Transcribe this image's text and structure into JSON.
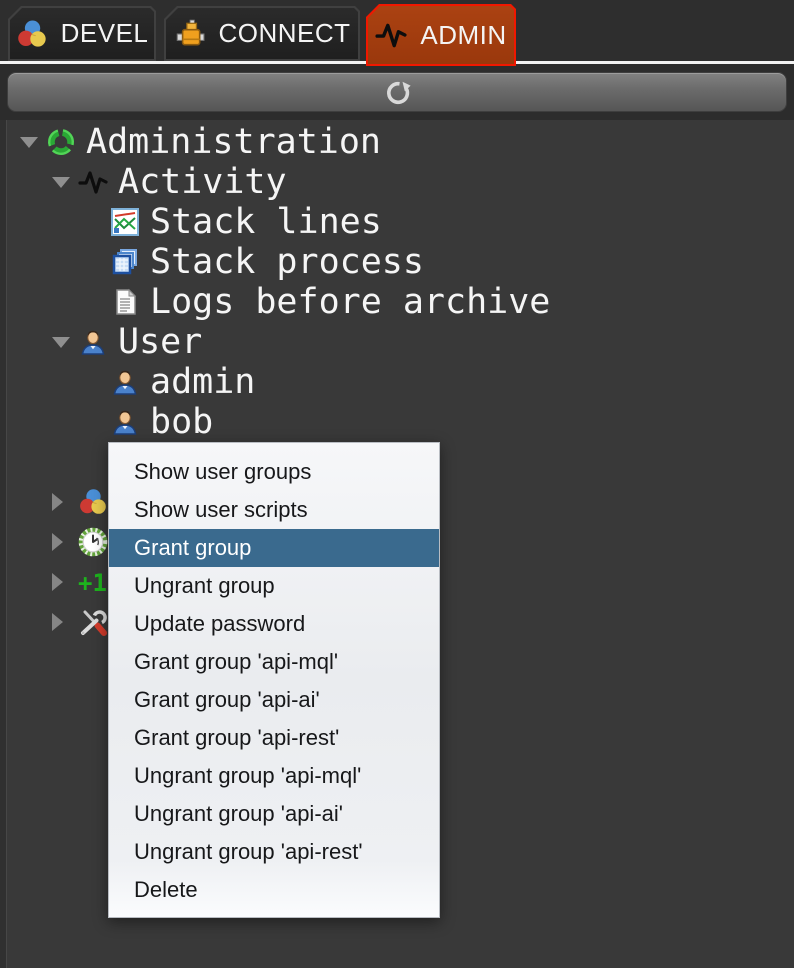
{
  "tabs": [
    {
      "label": "DEVEL",
      "icon": "color-circles-icon",
      "active": false
    },
    {
      "label": "CONNECT",
      "icon": "connector-icon",
      "active": false
    },
    {
      "label": "ADMIN",
      "icon": "pulse-icon",
      "active": true
    }
  ],
  "toolbar": {
    "refresh_icon": "refresh-icon"
  },
  "tree": {
    "items": [
      {
        "row": 0,
        "level": 0,
        "state": "expanded",
        "icon": "ring-icon",
        "label": "Administration"
      },
      {
        "row": 1,
        "level": 1,
        "state": "expanded",
        "icon": "pulse-icon",
        "label": "Activity"
      },
      {
        "row": 2,
        "level": 2,
        "state": "leaf",
        "icon": "chart-icon",
        "label": "Stack lines"
      },
      {
        "row": 3,
        "level": 2,
        "state": "leaf",
        "icon": "stack-icon",
        "label": "Stack process"
      },
      {
        "row": 4,
        "level": 2,
        "state": "leaf",
        "icon": "document-icon",
        "label": "Logs before archive"
      },
      {
        "row": 5,
        "level": 1,
        "state": "expanded",
        "icon": "user-icon",
        "label": "User"
      },
      {
        "row": 6,
        "level": 2,
        "state": "leaf",
        "icon": "user-icon",
        "label": "admin"
      },
      {
        "row": 7,
        "level": 2,
        "state": "leaf",
        "icon": "user-icon",
        "label": "bob"
      },
      {
        "row": 9,
        "level": 1,
        "state": "collapsed",
        "icon": "color-circles-icon",
        "label": ""
      },
      {
        "row": 10,
        "level": 1,
        "state": "collapsed",
        "icon": "clock-icon",
        "label": ""
      },
      {
        "row": 11,
        "level": 1,
        "state": "collapsed",
        "icon": "plus-one-icon",
        "label": ""
      },
      {
        "row": 12,
        "level": 1,
        "state": "collapsed",
        "icon": "tools-icon",
        "label": ""
      }
    ]
  },
  "context_menu": {
    "items": [
      {
        "label": "Show user groups",
        "highlighted": false
      },
      {
        "label": "Show user scripts",
        "highlighted": false
      },
      {
        "label": "Grant group",
        "highlighted": true
      },
      {
        "label": "Ungrant group",
        "highlighted": false
      },
      {
        "label": "Update password",
        "highlighted": false
      },
      {
        "label": "Grant group 'api-mql'",
        "highlighted": false
      },
      {
        "label": "Grant group 'api-ai'",
        "highlighted": false
      },
      {
        "label": "Grant group 'api-rest'",
        "highlighted": false
      },
      {
        "label": "Ungrant group 'api-mql'",
        "highlighted": false
      },
      {
        "label": "Ungrant group 'api-ai'",
        "highlighted": false
      },
      {
        "label": "Ungrant group 'api-rest'",
        "highlighted": false
      },
      {
        "label": "Delete",
        "highlighted": false
      }
    ]
  },
  "colors": {
    "panel_bg": "#393939",
    "active_tab_bg": "#a23c0e",
    "active_tab_border": "#f01800",
    "menu_bg": "#eef0f3",
    "menu_highlight_bg": "#3a6a8e",
    "menu_text": "#17181a",
    "tree_text": "#f5f5f5"
  }
}
